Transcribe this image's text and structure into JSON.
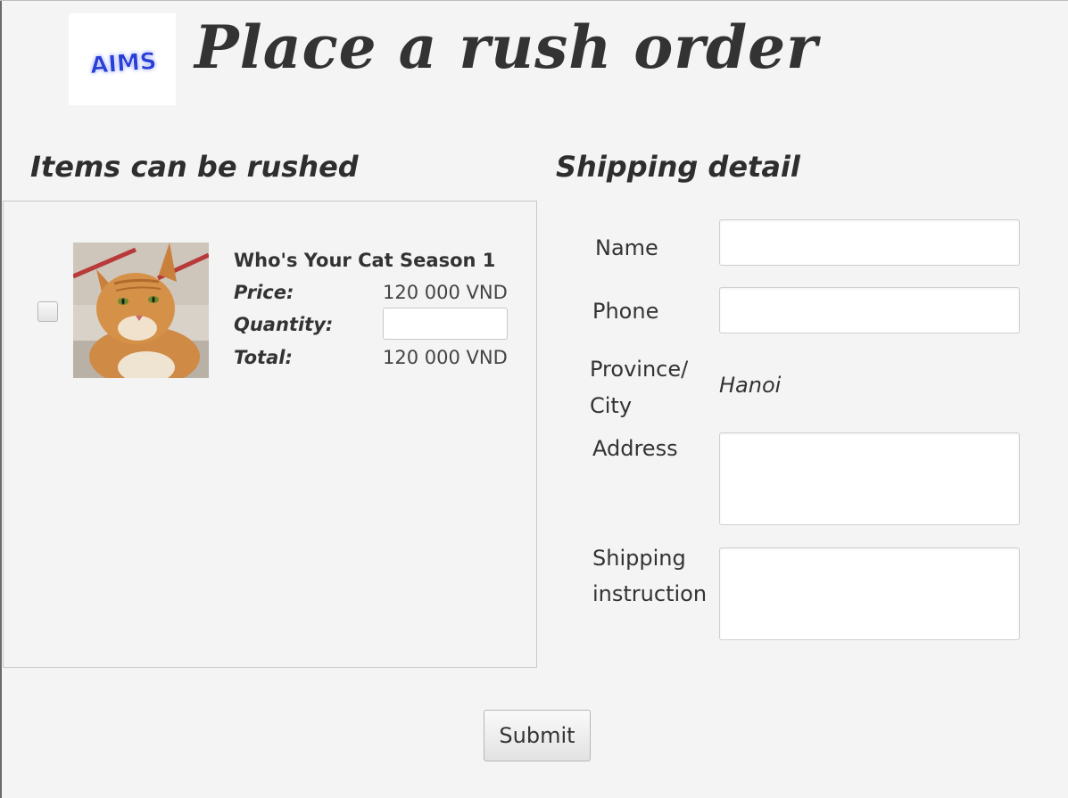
{
  "logo": {
    "text": "AIMS",
    "text_color": "#2a3fd6"
  },
  "header": {
    "title": "Place a rush order"
  },
  "items_section": {
    "title": "Items can be rushed",
    "items": [
      {
        "name": "Who's Your Cat Season 1",
        "image": "cat-photo",
        "price_label": "Price:",
        "price": "120 000 VND",
        "quantity_label": "Quantity:",
        "quantity_value": "",
        "total_label": "Total:",
        "total": "120 000 VND",
        "checked": false
      }
    ]
  },
  "shipping": {
    "title": "Shipping detail",
    "name_label": "Name",
    "name_value": "",
    "phone_label": "Phone",
    "phone_value": "",
    "province_label_line1": "Province/",
    "province_label_line2": "City",
    "province_value": "Hanoi",
    "address_label": "Address",
    "address_value": "",
    "instruction_label_line1": "Shipping",
    "instruction_label_line2": "instruction",
    "instruction_value": ""
  },
  "actions": {
    "submit_label": "Submit"
  }
}
